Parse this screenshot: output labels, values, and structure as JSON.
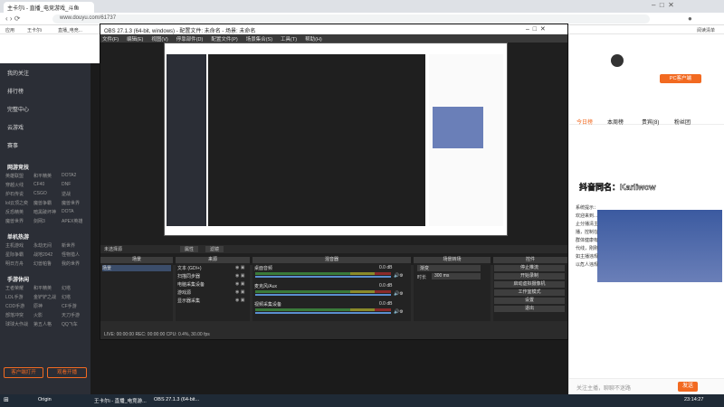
{
  "browser": {
    "tab_title": "主卡尔i - 直播_电竞游戏_斗鱼",
    "url": "www.douyu.com/61737",
    "bookmark_apps": "应用",
    "bookmark_1": "王卡尔i",
    "bookmark_2": "直播_电竞...",
    "reading_list": "阅读清单"
  },
  "leftnav": {
    "items": [
      "我的关注",
      "排行榜",
      "完整中心",
      "云游戏",
      "赛事"
    ],
    "section1": "网游竞技",
    "games1": [
      [
        "英雄联盟",
        "和平精英",
        "DOTA2"
      ],
      [
        "穿越火线",
        "CF40",
        "DNF"
      ],
      [
        "炉石传说",
        "CSGO",
        "逆战"
      ],
      [
        "lol云顶之奕",
        "魔兽争霸",
        "魔兽世界"
      ],
      [
        "反恐精英",
        "暗黑破坏神",
        "DOTA"
      ],
      [
        "魔兽世界",
        "剑网3",
        "APEX英雄"
      ]
    ],
    "section2": "单机热游",
    "games2": [
      [
        "主机游戏",
        "永劫无间",
        "新世界"
      ],
      [
        "星际争霸",
        "战地2042",
        "怪物猎人"
      ],
      [
        "明日方舟",
        "幻兽帕鲁",
        "我的世界"
      ]
    ],
    "section3": "手游休闲",
    "games3": [
      [
        "王者荣耀",
        "和平精英",
        "幻塔"
      ],
      [
        "LOL手游",
        "金铲铲之战",
        "幻塔"
      ],
      [
        "COD手游",
        "原神",
        "CF手游"
      ],
      [
        "部落冲突",
        "火影",
        "天刀手游"
      ],
      [
        "球球大作战",
        "第五人格",
        "QQ飞车"
      ]
    ],
    "btn_left": "客户端打开",
    "btn_right": "观看开播"
  },
  "obs": {
    "title": "OBS 27.1.3 (64-bit, windows) - 配置文件: 未命名 - 场景: 未命名",
    "menu": [
      "文件(F)",
      "编辑(E)",
      "视图(V)",
      "停靠部件(D)",
      "配置文件(P)",
      "场景集合(S)",
      "工具(T)",
      "帮助(H)"
    ],
    "scene_name": "场景",
    "no_source": "未选择源",
    "props_btn": "属性",
    "filters_btn": "滤镜",
    "dock_scenes": "场景",
    "dock_sources": "来源",
    "dock_mixer": "混音器",
    "dock_transitions": "场景转场",
    "dock_controls": "控件",
    "sources": [
      "文本 (GDI+)",
      "扫描同步器",
      "电脑采集设备",
      "游戏源",
      "显示器采集"
    ],
    "mixer": [
      {
        "name": "桌面音频",
        "db": "0.0 dB"
      },
      {
        "name": "麦克风/Aux",
        "db": "0.0 dB"
      },
      {
        "name": "视频采集设备",
        "db": "0.0 dB"
      }
    ],
    "transition_value": "渐变",
    "duration_label": "时长",
    "duration_value": "300 ms",
    "controls": [
      "停止推流",
      "开始录制",
      "启动虚拟摄像机",
      "工作室模式",
      "设置",
      "退出"
    ],
    "status": "LIVE: 00:00:00    REC: 00:00:00    CPU: 0.4%, 30.00 fps"
  },
  "right": {
    "client_btn": "PC客户端",
    "follow": "关注主播",
    "tabs": [
      "今日榜",
      "本周榜",
      "贵宾(8)",
      "粉丝团"
    ],
    "chat": [
      "系统提示：",
      "欢迎来到...",
      "止分播清主",
      "播，控制在",
      "群体健康有",
      "代线，刚刚",
      "如主播违规",
      "以危人违规"
    ],
    "chat_input": "关注主播，聊聊不迷路",
    "send": "发送",
    "overlay": "抖音同名：Karliwow"
  },
  "taskbar": {
    "item1": "王卡尔i - 直播_电竞游...",
    "item2": "OBS 27.1.3 (64-bit...",
    "origin": "Origin",
    "time": "23:14:27"
  }
}
